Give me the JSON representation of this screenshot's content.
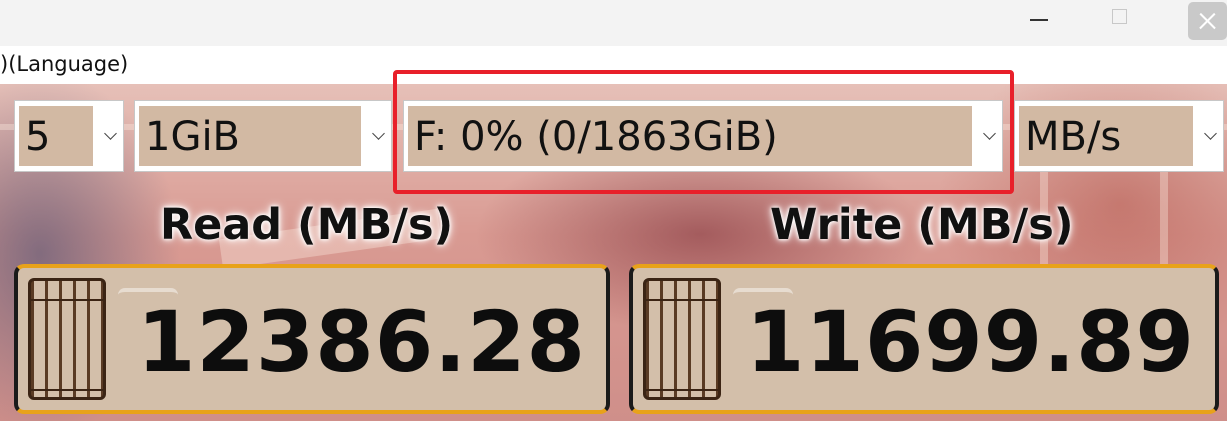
{
  "titlebar": {
    "minimize_icon": "minimize-icon",
    "maximize_icon": "maximize-icon",
    "close_icon": "close-icon"
  },
  "menu": {
    "language_label": ")(Language)"
  },
  "controls": {
    "count": "5",
    "size": "1GiB",
    "drive": "F: 0% (0/1863GiB)",
    "unit": "MB/s"
  },
  "highlight_color": "#e8202a",
  "read": {
    "title": "Read (MB/s)",
    "value": "12386.28"
  },
  "write": {
    "title": "Write (MB/s)",
    "value": "11699.89"
  }
}
